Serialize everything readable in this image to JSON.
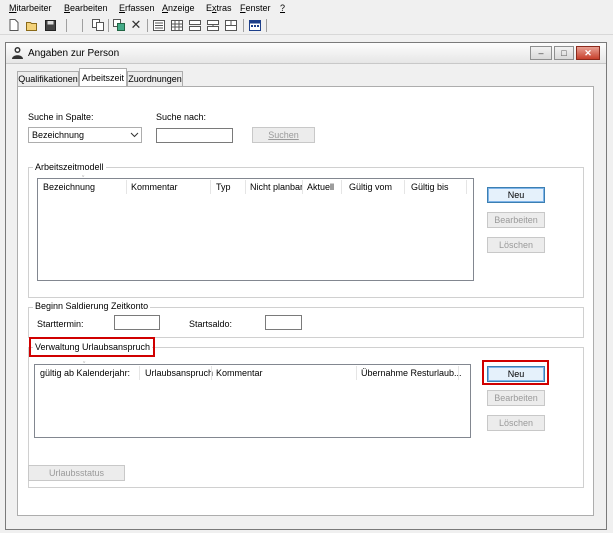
{
  "menubar": {
    "items": [
      {
        "first": "M",
        "rest": "itarbeiter"
      },
      {
        "first": "B",
        "rest": "earbeiten"
      },
      {
        "first": "E",
        "rest": "rfassen"
      },
      {
        "first": "A",
        "rest": "nzeige",
        "pre": ""
      },
      {
        "first": "x",
        "rest": "tras",
        "pre": "E"
      },
      {
        "first": "F",
        "rest": "enster"
      },
      {
        "first": "?",
        "rest": ""
      }
    ]
  },
  "window": {
    "title": "Angaben zur Person"
  },
  "tabs": [
    {
      "label": "Qualifikationen"
    },
    {
      "label": "Arbeitszeit"
    },
    {
      "label": "Zuordnungen"
    }
  ],
  "search": {
    "column_label": "Suche in Spalte:",
    "column_value": "Bezeichnung",
    "term_label": "Suche nach:",
    "term_value": "",
    "button": "Suchen"
  },
  "arbeitszeitmodell": {
    "title": "Arbeitszeitmodell",
    "columns": [
      "Bezeichnung",
      "Kommentar",
      "Typ",
      "Nicht planbar",
      "Aktuell",
      "Gültig vom",
      "Gültig bis"
    ],
    "buttons": {
      "new": "Neu",
      "edit": "Bearbeiten",
      "delete": "Löschen"
    }
  },
  "saldierung": {
    "title": "Beginn Saldierung Zeitkonto",
    "start_label": "Starttermin:",
    "start_value": "",
    "saldo_label": "Startsaldo:",
    "saldo_value": ""
  },
  "urlaub": {
    "title": "Verwaltung Urlaubsanspruch",
    "columns": [
      "gültig ab Kalenderjahr:",
      "Urlaubsanspruch",
      "Kommentar",
      "Übernahme Resturlaub..."
    ],
    "buttons": {
      "new": "Neu",
      "edit": "Bearbeiten",
      "delete": "Löschen"
    }
  },
  "footer": {
    "status_button": "Urlaubsstatus"
  }
}
